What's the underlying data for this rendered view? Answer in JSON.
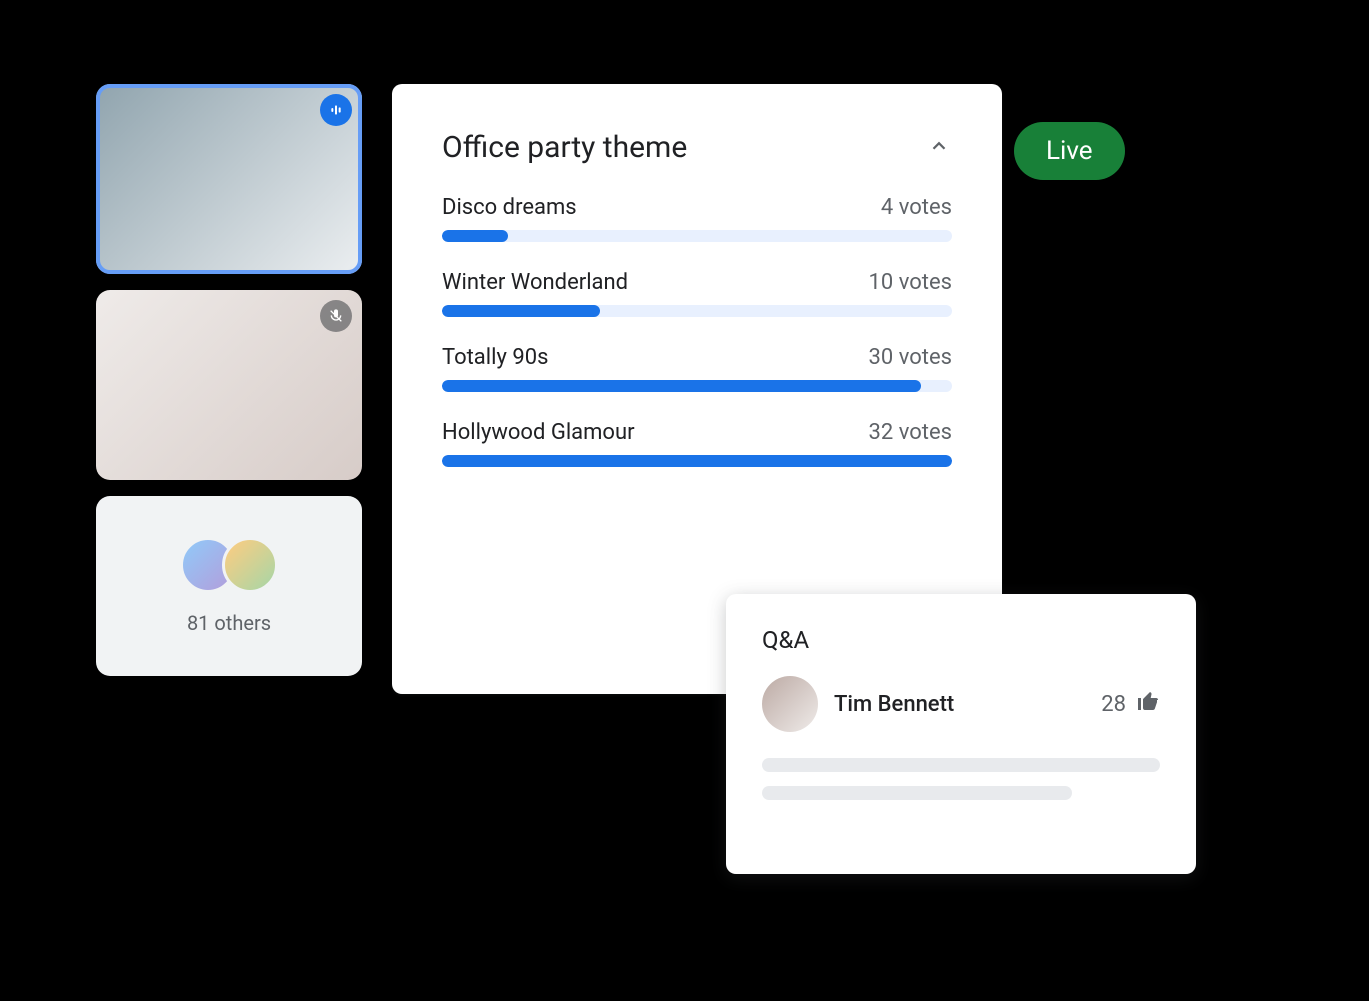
{
  "participants": {
    "tile1_status": "speaking",
    "tile2_status": "muted",
    "others_count_label": "81 others"
  },
  "live_badge": "Live",
  "poll": {
    "title": "Office party theme",
    "max_votes": 32,
    "options": [
      {
        "label": "Disco dreams",
        "votes": 4,
        "votes_label": "4 votes"
      },
      {
        "label": "Winter Wonderland",
        "votes": 10,
        "votes_label": "10 votes"
      },
      {
        "label": "Totally 90s",
        "votes": 30,
        "votes_label": "30 votes"
      },
      {
        "label": "Hollywood Glamour",
        "votes": 32,
        "votes_label": "32 votes"
      }
    ]
  },
  "qa": {
    "title": "Q&A",
    "entry": {
      "name": "Tim Bennett",
      "upvotes": "28"
    }
  },
  "chart_data": {
    "type": "bar",
    "title": "Office party theme",
    "categories": [
      "Disco dreams",
      "Winter Wonderland",
      "Totally 90s",
      "Hollywood Glamour"
    ],
    "values": [
      4,
      10,
      30,
      32
    ],
    "xlabel": "",
    "ylabel": "votes",
    "ylim": [
      0,
      32
    ]
  }
}
